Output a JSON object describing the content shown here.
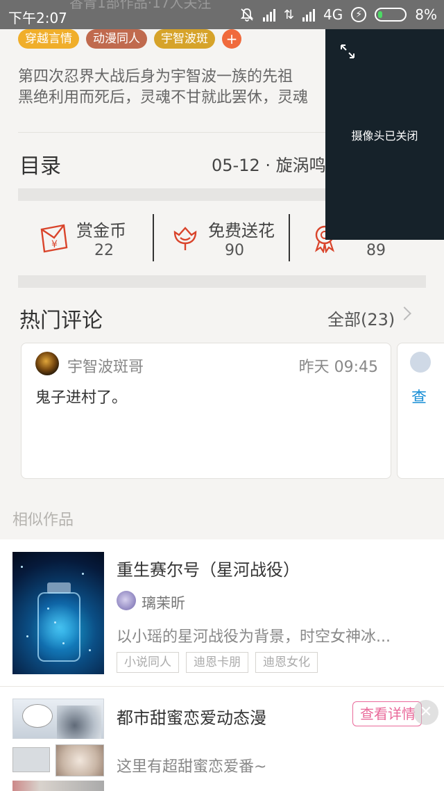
{
  "status_bar": {
    "time": "下午2:07",
    "overlap_text": "香青1部作品·17人关注",
    "network": "4G",
    "battery_percent": "8%"
  },
  "tags": [
    {
      "label": "穿越言情",
      "color": "#f0ae2a"
    },
    {
      "label": "动漫同人",
      "color": "#c06a4e"
    },
    {
      "label": "宇智波斑",
      "color": "#d6a32a"
    },
    {
      "label": "+",
      "color": "#f06a3c"
    }
  ],
  "description": {
    "line1": "第四次忍界大战后身为宇智波一族的先祖",
    "line2": "黑绝利用而死后，灵魂不甘就此罢休，灵魂"
  },
  "catalog": {
    "title": "目录",
    "latest": "05-12 · 旋涡鸣"
  },
  "stats": [
    {
      "label": "赏金币",
      "value": "22",
      "icon": "red-envelope-icon"
    },
    {
      "label": "免费送花",
      "value": "90",
      "icon": "flower-icon"
    },
    {
      "label": "",
      "value": "89",
      "icon": "award-icon"
    }
  ],
  "hot_comments": {
    "title": "热门评论",
    "all_label": "全部(23)",
    "items": [
      {
        "user": "宇智波斑哥",
        "time": "昨天 09:45",
        "text": "鬼子进村了。"
      },
      {
        "link_text": "查"
      }
    ]
  },
  "similar": {
    "title": "相似作品",
    "items": [
      {
        "title": "重生赛尔号（星河战役）",
        "author": "璃茉昕",
        "summary": "以小瑶的星河战役为背景，时空女神冰...",
        "chips": [
          "小说同人",
          "迪恩卡朋",
          "迪恩女化"
        ]
      },
      {
        "title": "都市甜蜜恋爱动态漫",
        "detail_button": "查看详情",
        "close": "✕",
        "slogan": "这里有超甜蜜恋爱番~"
      }
    ]
  },
  "camera_overlay": {
    "message": "摄像头已关闭"
  }
}
